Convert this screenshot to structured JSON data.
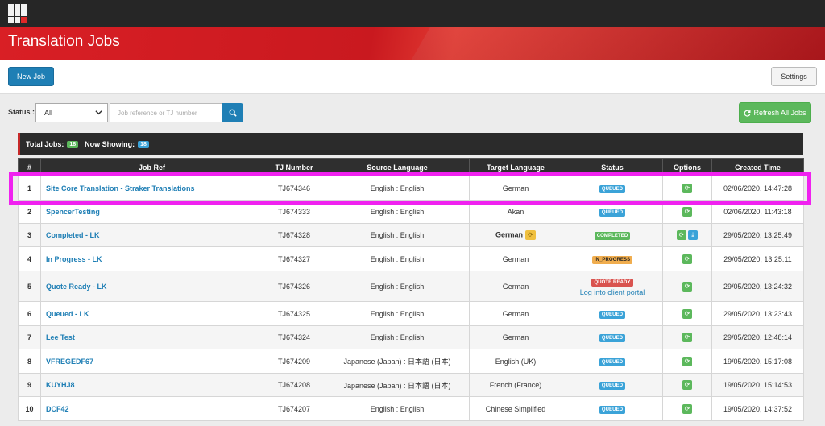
{
  "window": {
    "title": "Translation Jobs"
  },
  "toolbar": {
    "new_job_label": "New Job",
    "settings_label": "Settings"
  },
  "filters": {
    "status_label": "Status :",
    "status_value": "All",
    "search_placeholder": "Job reference or TJ number",
    "refresh_label": "Refresh All Jobs"
  },
  "summary": {
    "total_label": "Total Jobs:",
    "total_count": "18",
    "showing_label": "Now Showing:",
    "showing_count": "18"
  },
  "table": {
    "headers": [
      "#",
      "Job Ref",
      "TJ Number",
      "Source Language",
      "Target Language",
      "Status",
      "Options",
      "Created Time"
    ],
    "rows": [
      {
        "num": "1",
        "ref": "Site Core Translation - Straker Translations",
        "tj": "TJ674346",
        "source": "English : English",
        "target": "German",
        "status": "QUEUED",
        "created": "02/06/2020, 14:47:28"
      },
      {
        "num": "2",
        "ref": "SpencerTesting",
        "tj": "TJ674333",
        "source": "English : English",
        "target": "Akan",
        "status": "QUEUED",
        "created": "02/06/2020, 11:43:18"
      },
      {
        "num": "3",
        "ref": "Completed - LK",
        "tj": "TJ674328",
        "source": "English : English",
        "target": "German",
        "status": "COMPLETED",
        "created": "29/05/2020, 13:25:49"
      },
      {
        "num": "4",
        "ref": "In Progress - LK",
        "tj": "TJ674327",
        "source": "English : English",
        "target": "German",
        "status": "IN_PROGRESS",
        "created": "29/05/2020, 13:25:11"
      },
      {
        "num": "5",
        "ref": "Quote Ready - LK",
        "tj": "TJ674326",
        "source": "English : English",
        "target": "German",
        "status": "QUOTE READY",
        "portal_link": "Log into client portal",
        "created": "29/05/2020, 13:24:32"
      },
      {
        "num": "6",
        "ref": "Queued - LK",
        "tj": "TJ674325",
        "source": "English : English",
        "target": "German",
        "status": "QUEUED",
        "created": "29/05/2020, 13:23:43"
      },
      {
        "num": "7",
        "ref": "Lee Test",
        "tj": "TJ674324",
        "source": "English : English",
        "target": "German",
        "status": "QUEUED",
        "created": "29/05/2020, 12:48:14"
      },
      {
        "num": "8",
        "ref": "VFREGEDF67",
        "tj": "TJ674209",
        "source": "Japanese (Japan) : 日本語 (日本)",
        "target": "English (UK)",
        "status": "QUEUED",
        "created": "19/05/2020, 15:17:08"
      },
      {
        "num": "9",
        "ref": "KUYHJ8",
        "tj": "TJ674208",
        "source": "Japanese (Japan) : 日本語 (日本)",
        "target": "French (France)",
        "status": "QUEUED",
        "created": "19/05/2020, 15:14:53"
      },
      {
        "num": "10",
        "ref": "DCF42",
        "tj": "TJ674207",
        "source": "English : English",
        "target": "Chinese Simplified",
        "status": "QUEUED",
        "created": "19/05/2020, 14:37:52"
      }
    ]
  },
  "colors": {
    "accent": "#1f7fb5",
    "brand_red": "#d91f25",
    "highlight": "#f021f0",
    "success": "#5cb85c"
  },
  "icons": [
    "app-grid-icon",
    "search-icon",
    "refresh-icon",
    "download-icon",
    "chevron-down-icon"
  ]
}
